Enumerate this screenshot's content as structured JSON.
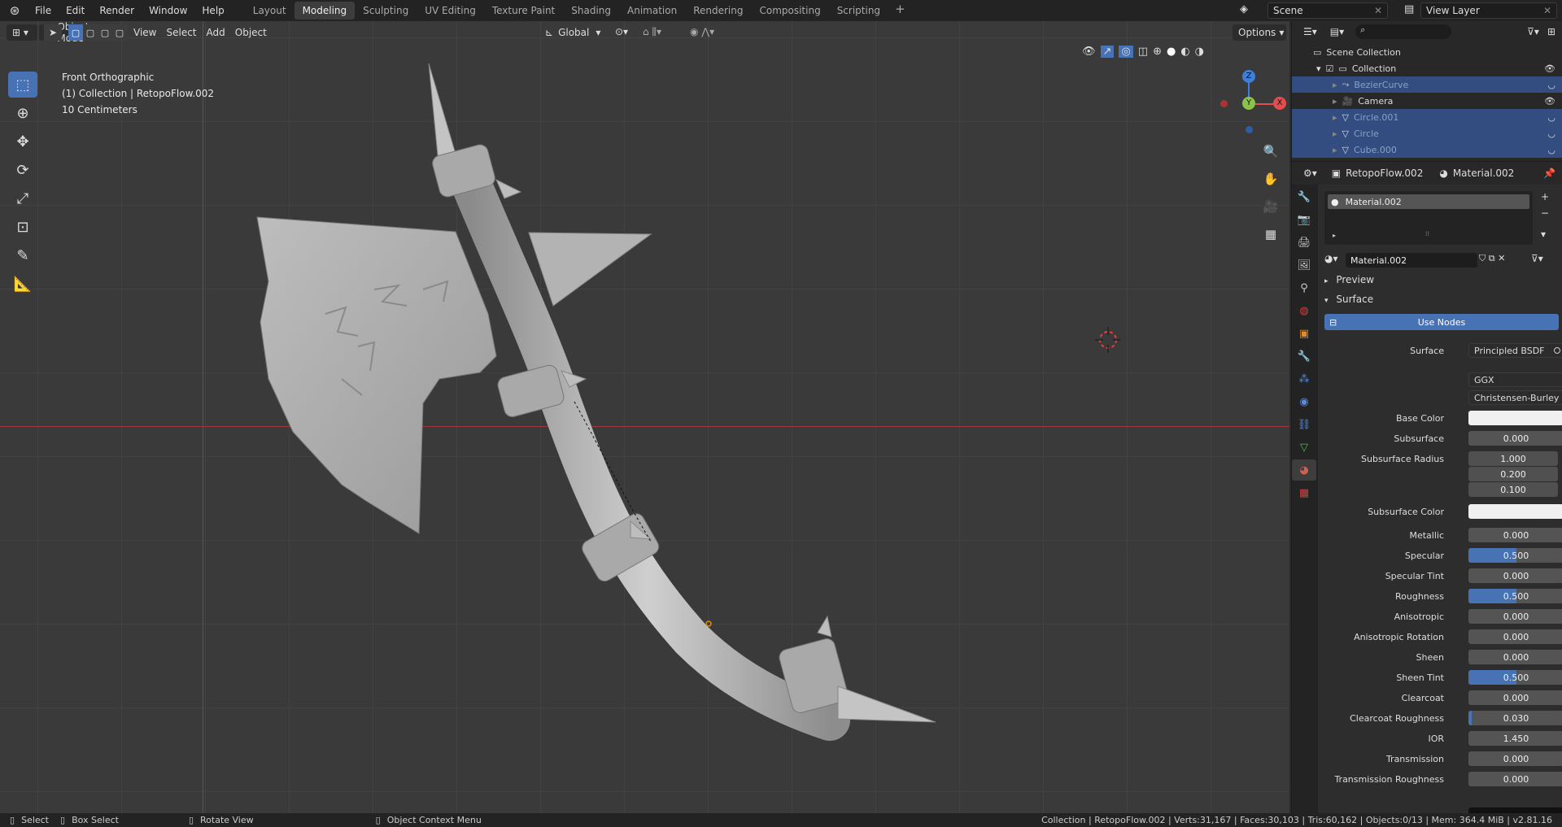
{
  "topbar": {
    "menus": [
      "File",
      "Edit",
      "Render",
      "Window",
      "Help"
    ],
    "workspaces": [
      "Layout",
      "Modeling",
      "Sculpting",
      "UV Editing",
      "Texture Paint",
      "Shading",
      "Animation",
      "Rendering",
      "Compositing",
      "Scripting"
    ],
    "active_workspace": "Modeling",
    "scene": "Scene",
    "view_layer": "View Layer"
  },
  "viewport": {
    "mode": "Object Mode",
    "menus": [
      "View",
      "Select",
      "Add",
      "Object"
    ],
    "transform_orientation": "Global",
    "options_label": "Options",
    "view_name": "Front Orthographic",
    "collection_info": "(1) Collection | RetopoFlow.002",
    "grid_scale": "10 Centimeters",
    "gizmo": {
      "z": "Z",
      "y": "Y",
      "x": "X"
    }
  },
  "outliner": {
    "root": "Scene Collection",
    "collection": "Collection",
    "items": [
      {
        "name": "BezierCurve",
        "selected": true
      },
      {
        "name": "Camera",
        "selected": false
      },
      {
        "name": "Circle.001",
        "selected": true
      },
      {
        "name": "Circle",
        "selected": true
      },
      {
        "name": "Cube.000",
        "selected": true
      }
    ]
  },
  "properties": {
    "object_name": "RetopoFlow.002",
    "material_header": "Material.002",
    "slot_name": "Material.002",
    "material_name": "Material.002",
    "preview_label": "Preview",
    "surface_section": "Surface",
    "use_nodes": "Use Nodes",
    "surface_label": "Surface",
    "surface_shader": "Principled BSDF",
    "distribution": "GGX",
    "subsurface_method": "Christensen-Burley",
    "base_color_label": "Base Color",
    "subsurface_color_label": "Subsurface Color",
    "subsurface_radius_label": "Subsurface Radius",
    "subsurface_radius": [
      "1.000",
      "0.200",
      "0.100"
    ],
    "fields": [
      {
        "label": "Subsurface",
        "value": "0.000",
        "fill": 0
      },
      {
        "label": "Metallic",
        "value": "0.000",
        "fill": 0
      },
      {
        "label": "Specular",
        "value": "0.500",
        "fill": 0.5
      },
      {
        "label": "Specular Tint",
        "value": "0.000",
        "fill": 0
      },
      {
        "label": "Roughness",
        "value": "0.500",
        "fill": 0.5
      },
      {
        "label": "Anisotropic",
        "value": "0.000",
        "fill": 0
      },
      {
        "label": "Anisotropic Rotation",
        "value": "0.000",
        "fill": 0
      },
      {
        "label": "Sheen",
        "value": "0.000",
        "fill": 0
      },
      {
        "label": "Sheen Tint",
        "value": "0.500",
        "fill": 0.5
      },
      {
        "label": "Clearcoat",
        "value": "0.000",
        "fill": 0
      },
      {
        "label": "Clearcoat Roughness",
        "value": "0.030",
        "fill": 0.03
      },
      {
        "label": "IOR",
        "value": "1.450",
        "fill": 0
      },
      {
        "label": "Transmission",
        "value": "0.000",
        "fill": 0
      },
      {
        "label": "Transmission Roughness",
        "value": "0.000",
        "fill": 0
      }
    ]
  },
  "statusbar": {
    "select": "Select",
    "box_select": "Box Select",
    "rotate": "Rotate View",
    "context": "Object Context Menu",
    "stats": "Collection | RetopoFlow.002 | Verts:31,167 | Faces:30,103 | Tris:60,162 | Objects:0/13 | Mem: 364.4 MiB | v2.81.16"
  },
  "colors": {
    "accent": "#4772b3",
    "x_axis": "#e44d4d",
    "y_axis": "#8bc34a",
    "z_axis": "#3f7fd8"
  }
}
